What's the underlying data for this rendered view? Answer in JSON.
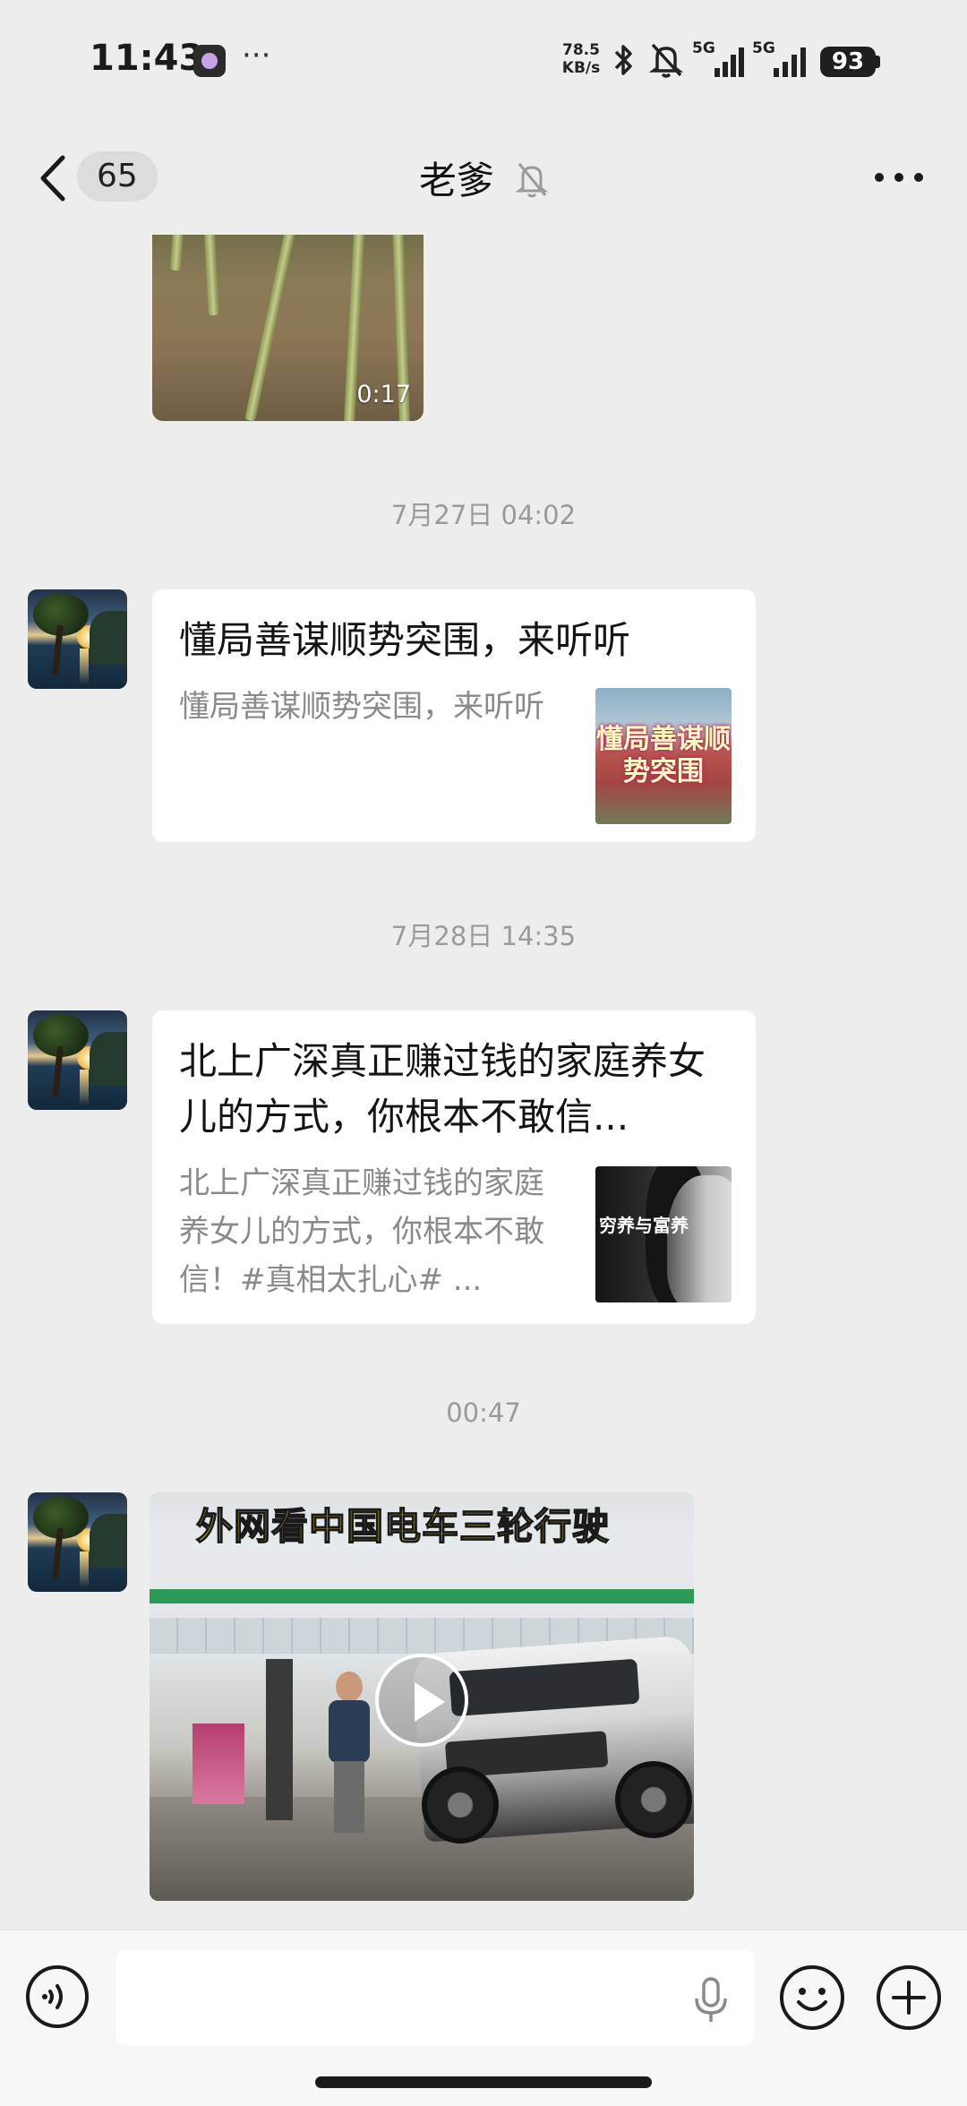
{
  "status_bar": {
    "time": "11:43",
    "more": "···",
    "net_speed_value": "78.5",
    "net_speed_unit": "KB/s",
    "sim1": "5G",
    "sim2": "5G",
    "battery": "93"
  },
  "nav": {
    "unread_count": "65",
    "title": "老爹",
    "muted": true
  },
  "messages": {
    "video_top": {
      "duration": "0:17"
    },
    "ts1": "7月27日 04:02",
    "card1": {
      "title": "懂局善谋顺势突围，来听听",
      "desc": "懂局善谋顺势突围，来听听",
      "thumb_text": "懂局善谋顺势突围"
    },
    "ts2": "7月28日 14:35",
    "card2": {
      "title": "北上广深真正赚过钱的家庭养女儿的方式，你根本不敢信...",
      "desc": "北上广深真正赚过钱的家庭养女儿的方式，你根本不敢信！#真相太扎心# ...",
      "thumb_text": "穷养与富养"
    },
    "ts3": "00:47",
    "video_bottom": {
      "headline": "外网看中国电车三轮行驶"
    }
  },
  "input_bar": {
    "text": ""
  },
  "colors": {
    "background": "#ededed",
    "bubble": "#ffffff",
    "timestamp": "#9a9a9a",
    "headline_yellow": "#ffe23a"
  },
  "icons": [
    "back-chevron-icon",
    "mute-bell-icon",
    "more-icon",
    "voice-input-icon",
    "mic-icon",
    "emoji-icon",
    "plus-icon"
  ]
}
